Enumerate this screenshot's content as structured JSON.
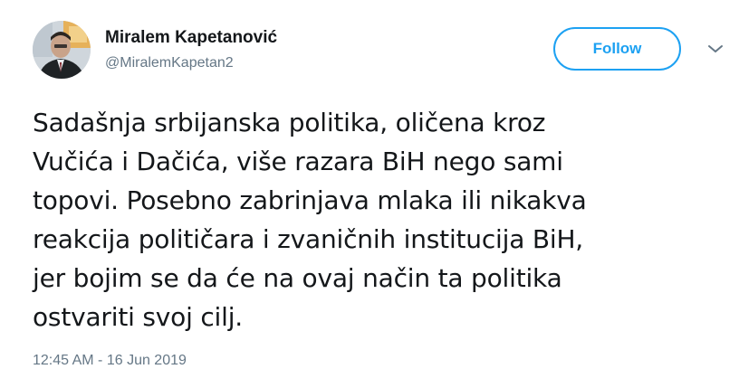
{
  "tweet": {
    "author_name": "Miralem Kapetanović",
    "author_handle": "@MiralemKapetan2",
    "follow_label": "Follow",
    "text_lines": [
      "Sadašnja srbijanska politika, oličena kroz",
      "Vučića i Dačića, više razara BiH nego sami",
      "topovi. Posebno zabrinjava mlaka ili nikakva",
      "reakcija političara i zvaničnih institucija BiH,",
      "jer bojim se da će na ovaj način ta politika",
      "ostvariti svoj cilj."
    ],
    "timestamp": "12:45 AM - 16 Jun 2019"
  },
  "icons": {
    "menu": "chevron-down-icon",
    "avatar": "profile-photo"
  },
  "colors": {
    "accent": "#1da1f2",
    "text_primary": "#14171a",
    "text_secondary": "#657786"
  }
}
